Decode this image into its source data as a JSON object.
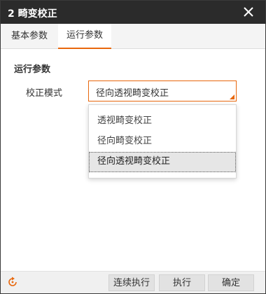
{
  "window": {
    "title": "2 畸变校正",
    "close_icon": "close-icon"
  },
  "tabs": [
    {
      "label": "基本参数",
      "active": false
    },
    {
      "label": "运行参数",
      "active": true
    }
  ],
  "section": {
    "title": "运行参数"
  },
  "field": {
    "label": "校正模式",
    "selected": "径向透视畸变校正",
    "options": [
      "透视畸变校正",
      "径向畸变校正",
      "径向透视畸变校正"
    ]
  },
  "footer": {
    "refresh_icon": "refresh-icon",
    "buttons": [
      "连续执行",
      "执行",
      "确定"
    ]
  },
  "colors": {
    "accent": "#e8670c",
    "titlebar": "#2b2b2b"
  }
}
